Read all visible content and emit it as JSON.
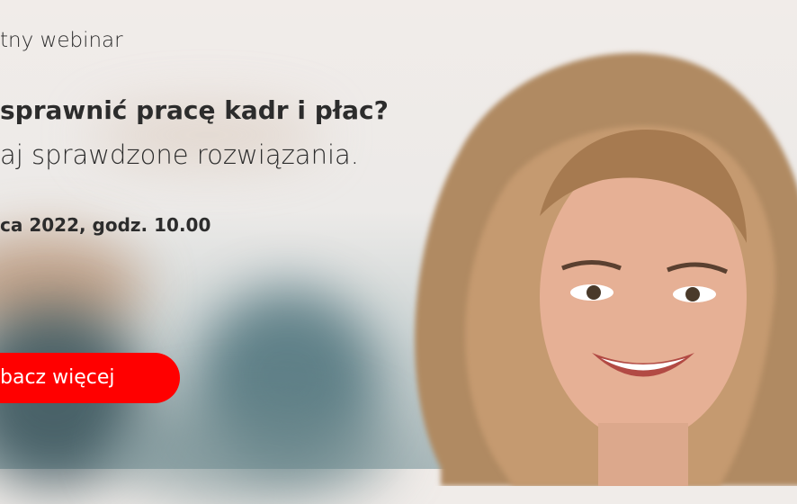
{
  "banner": {
    "eyebrow": "tny webinar",
    "headline": "sprawnić pracę kadr i płac?",
    "subheadline": "aj sprawdzone rozwiązania.",
    "date": "ca 2022, godz. 10.00",
    "cta_label": "bacz więcej",
    "cta_color": "#ff0000"
  }
}
